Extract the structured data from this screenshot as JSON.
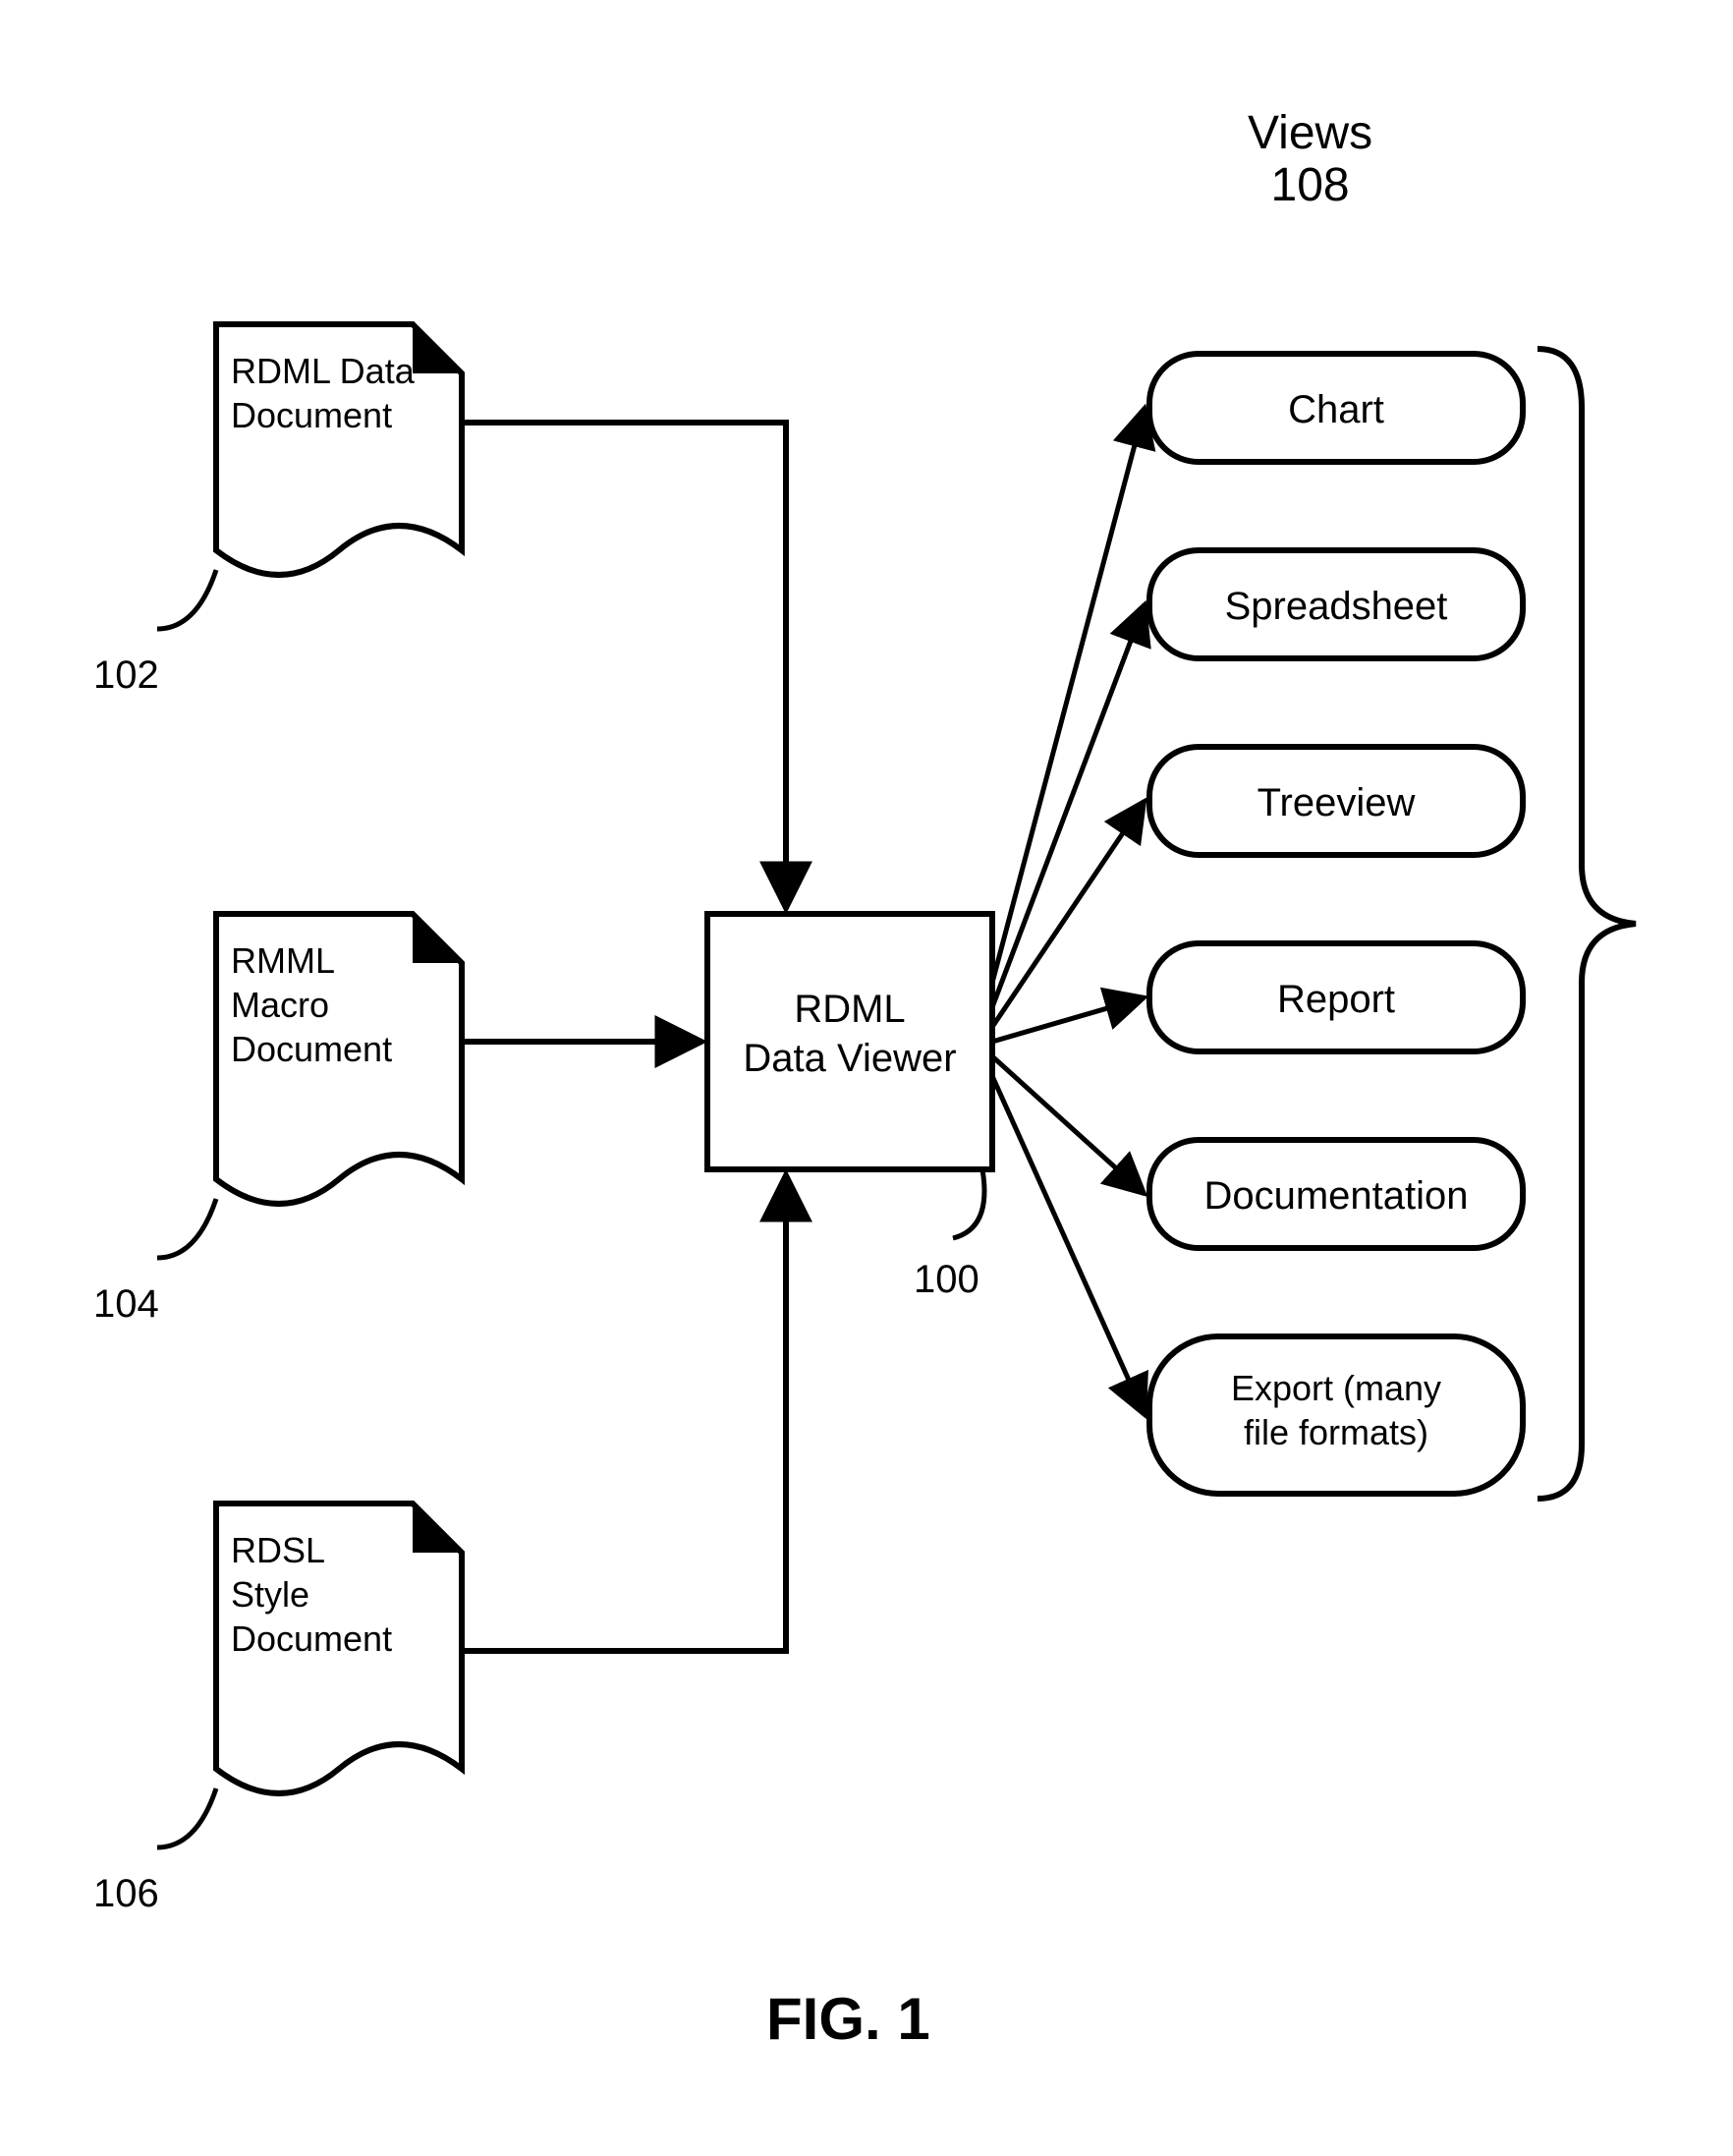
{
  "figure_label": "FIG. 1",
  "views_group": {
    "label": "Views",
    "ref": "108"
  },
  "processor": {
    "line1": "RDML",
    "line2": "Data Viewer",
    "ref": "100"
  },
  "inputs": {
    "data": {
      "line1": "RDML Data",
      "line2": "Document",
      "ref": "102"
    },
    "macro": {
      "line1": "RMML",
      "line2": "Macro",
      "line3": "Document",
      "ref": "104"
    },
    "style": {
      "line1": "RDSL",
      "line2": "Style",
      "line3": "Document",
      "ref": "106"
    }
  },
  "outputs": {
    "chart": {
      "label": "Chart"
    },
    "spread": {
      "label": "Spreadsheet"
    },
    "tree": {
      "label": "Treeview"
    },
    "report": {
      "label": "Report"
    },
    "doc": {
      "label": "Documentation"
    },
    "export": {
      "line1": "Export (many",
      "line2": "file formats)"
    }
  }
}
